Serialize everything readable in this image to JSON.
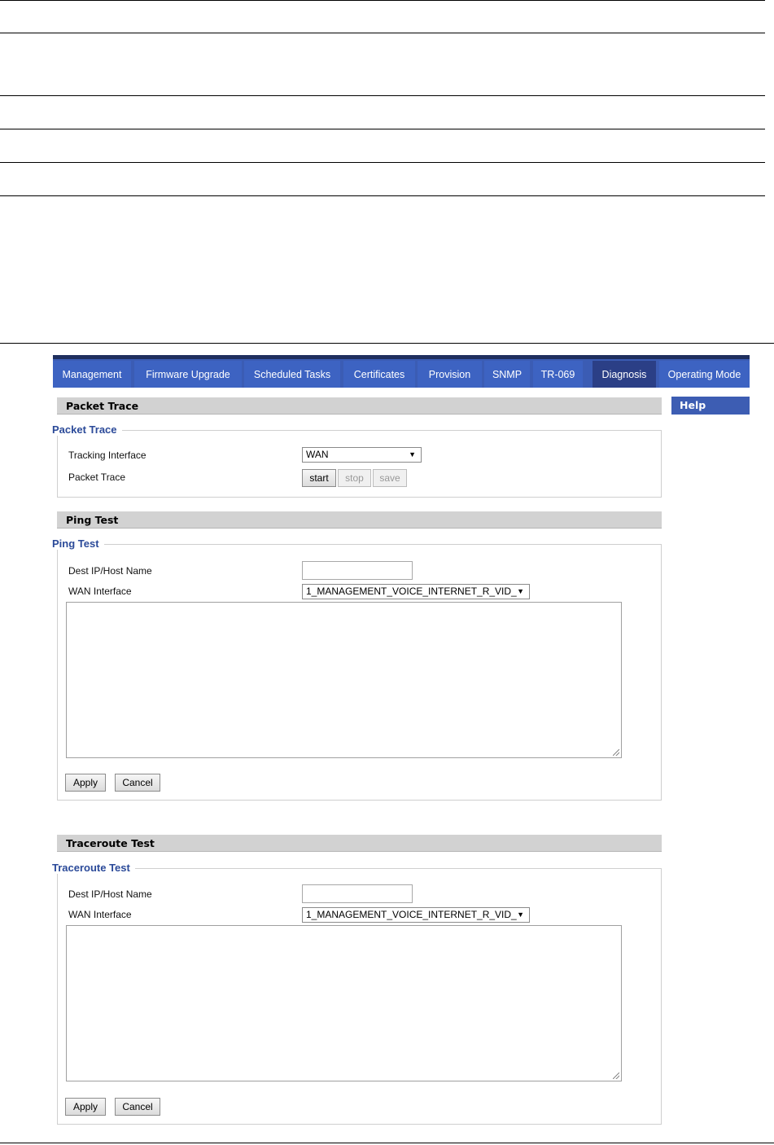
{
  "tabs": [
    "Management",
    "Firmware Upgrade",
    "Scheduled Tasks",
    "Certificates",
    "Provision",
    "SNMP",
    "TR-069",
    "Diagnosis",
    "Operating Mode"
  ],
  "active_tab": "Diagnosis",
  "help": {
    "label": "Help"
  },
  "packet_trace": {
    "header": "Packet Trace",
    "legend": "Packet Trace",
    "tracking_interface_label": "Tracking Interface",
    "tracking_interface_value": "WAN",
    "packet_trace_label": "Packet Trace",
    "start_label": "start",
    "stop_label": "stop",
    "save_label": "save"
  },
  "ping_test": {
    "header": "Ping Test",
    "legend": "Ping Test",
    "dest_label": "Dest IP/Host Name",
    "dest_value": "",
    "wan_label": "WAN Interface",
    "wan_value": "1_MANAGEMENT_VOICE_INTERNET_R_VID_",
    "apply_label": "Apply",
    "cancel_label": "Cancel"
  },
  "traceroute_test": {
    "header": "Traceroute Test",
    "legend": "Traceroute Test",
    "dest_label": "Dest IP/Host Name",
    "dest_value": "",
    "wan_label": "WAN Interface",
    "wan_value": "1_MANAGEMENT_VOICE_INTERNET_R_VID_",
    "apply_label": "Apply",
    "cancel_label": "Cancel"
  },
  "icons": {
    "caret": "caret-down-icon",
    "resize": "resize-grip-icon"
  }
}
